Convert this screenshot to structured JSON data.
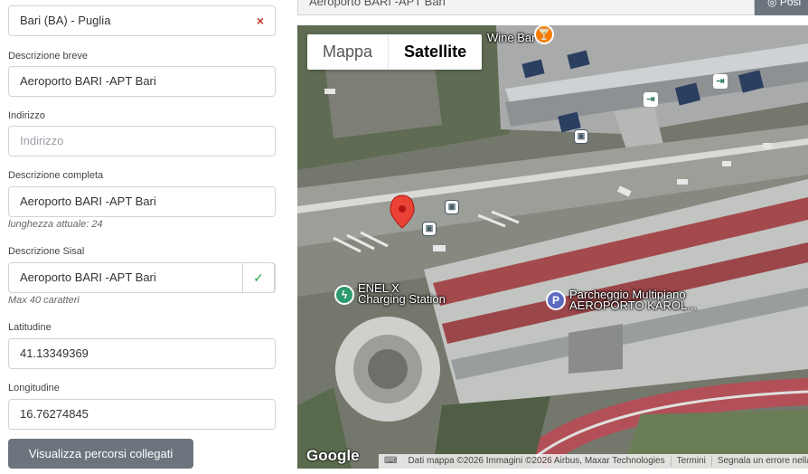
{
  "form": {
    "province_value": "Bari (BA) - Puglia",
    "short_desc_label": "Descrizione breve",
    "short_desc_value": "Aeroporto BARI -APT Bari",
    "address_label": "Indirizzo",
    "address_placeholder": "Indirizzo",
    "full_desc_label": "Descrizione completa",
    "full_desc_value": "Aeroporto BARI -APT Bari",
    "full_desc_hint": "lunghezza attuale: 24",
    "sisal_desc_label": "Descrizione Sisal",
    "sisal_desc_value": "Aeroporto BARI -APT Bari",
    "sisal_desc_hint": "Max 40 caratteri",
    "lat_label": "Latitudine",
    "lat_value": "41.13349369",
    "lon_label": "Longitudine",
    "lon_value": "16.76274845",
    "linked_routes_button": "Visualizza percorsi collegati"
  },
  "search": {
    "value": "Aeroporto BARI -APT Bari",
    "position_button": "Posi"
  },
  "map": {
    "type_map": "Mappa",
    "type_satellite": "Satellite",
    "active_type": "Satellite",
    "poi_wine_bar": "Wine Bar",
    "poi_enel_line1": "ENEL X",
    "poi_enel_line2": "Charging Station",
    "poi_parking_line1": "Parcheggio Multipiano",
    "poi_parking_line2": "AEROPORTO KAROL...",
    "parking_letter": "P",
    "google_logo": "Google",
    "attribution": "Dati mappa ©2026 Immagini ©2026 Airbus, Maxar Technologies",
    "terms": "Termini",
    "report": "Segnala un errore nella mappa",
    "marker_color": "#ea4335",
    "parking_color": "#5c6bc0",
    "charging_color": "#2e9b6e",
    "wine_bar_color": "#f57c00"
  }
}
